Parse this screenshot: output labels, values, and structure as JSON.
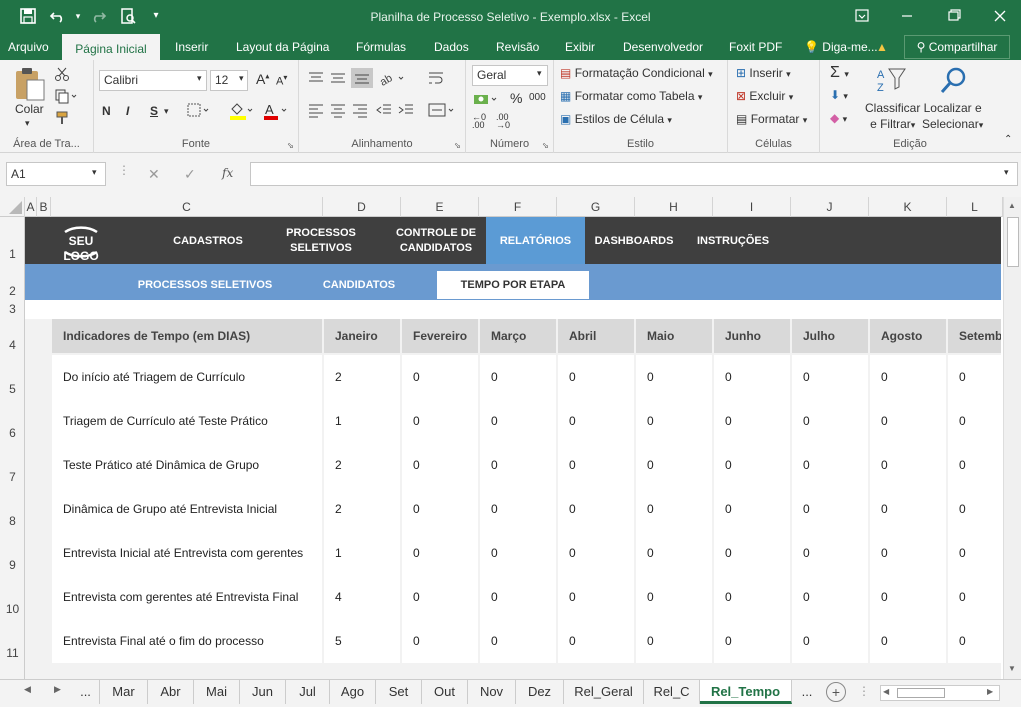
{
  "window": {
    "title": "Planilha de Processo Seletivo - Exemplo.xlsx - Excel"
  },
  "ribbon_tabs": [
    "Arquivo",
    "Página Inicial",
    "Inserir",
    "Layout da Página",
    "Fórmulas",
    "Dados",
    "Revisão",
    "Exibir",
    "Desenvolvedor",
    "Foxit PDF"
  ],
  "tell_me": "Diga-me...",
  "share": "Compartilhar",
  "clipboard": {
    "paste": "Colar",
    "label": "Área de Tra..."
  },
  "font": {
    "name": "Calibri",
    "size": "12",
    "bold": "N",
    "italic": "I",
    "underline": "S",
    "label": "Fonte"
  },
  "alignment": {
    "label": "Alinhamento"
  },
  "number": {
    "format": "Geral",
    "label": "Número"
  },
  "styles": {
    "cond": "Formatação Condicional",
    "table": "Formatar como Tabela",
    "cell": "Estilos de Célula",
    "label": "Estilo"
  },
  "cells": {
    "insert": "Inserir",
    "delete": "Excluir",
    "format": "Formatar",
    "label": "Células"
  },
  "editing": {
    "sort1": "Classificar",
    "sort2": "e Filtrar",
    "find1": "Localizar e",
    "find2": "Selecionar",
    "label": "Edição"
  },
  "formula_bar": {
    "name_box": "A1",
    "fx": "fx",
    "content": ""
  },
  "columns": [
    "A",
    "B",
    "C",
    "D",
    "E",
    "F",
    "G",
    "H",
    "I",
    "J",
    "K",
    "L"
  ],
  "rows": [
    "1",
    "2",
    "3",
    "4",
    "5",
    "6",
    "7",
    "8",
    "9",
    "10",
    "11"
  ],
  "nav": {
    "logo": "SEU LOGO",
    "items": [
      {
        "label": "CADASTROS"
      },
      {
        "label": "PROCESSOS\nSELETIVOS"
      },
      {
        "label": "CONTROLE DE\nCANDIDATOS"
      },
      {
        "label": "RELATÓRIOS"
      },
      {
        "label": "DASHBOARDS"
      },
      {
        "label": "INSTRUÇÕES"
      }
    ]
  },
  "subnav": [
    "PROCESSOS SELETIVOS",
    "CANDIDATOS",
    "TEMPO POR ETAPA"
  ],
  "table": {
    "header": [
      "Indicadores de Tempo (em DIAS)",
      "Janeiro",
      "Fevereiro",
      "Março",
      "Abril",
      "Maio",
      "Junho",
      "Julho",
      "Agosto",
      "Setemb"
    ],
    "rows": [
      {
        "label": "Do início até Triagem de Currículo",
        "values": [
          "2",
          "0",
          "0",
          "0",
          "0",
          "0",
          "0",
          "0",
          "0"
        ]
      },
      {
        "label": "Triagem de Currículo até Teste Prático",
        "values": [
          "1",
          "0",
          "0",
          "0",
          "0",
          "0",
          "0",
          "0",
          "0"
        ]
      },
      {
        "label": "Teste Prático até Dinâmica de Grupo",
        "values": [
          "2",
          "0",
          "0",
          "0",
          "0",
          "0",
          "0",
          "0",
          "0"
        ]
      },
      {
        "label": "Dinâmica de Grupo até Entrevista Inicial",
        "values": [
          "2",
          "0",
          "0",
          "0",
          "0",
          "0",
          "0",
          "0",
          "0"
        ]
      },
      {
        "label": "Entrevista Inicial até Entrevista com gerentes",
        "values": [
          "1",
          "0",
          "0",
          "0",
          "0",
          "0",
          "0",
          "0",
          "0"
        ]
      },
      {
        "label": "Entrevista com gerentes até Entrevista Final",
        "values": [
          "4",
          "0",
          "0",
          "0",
          "0",
          "0",
          "0",
          "0",
          "0"
        ]
      },
      {
        "label": "Entrevista Final até o fim do processo",
        "values": [
          "5",
          "0",
          "0",
          "0",
          "0",
          "0",
          "0",
          "0",
          "0"
        ]
      }
    ]
  },
  "sheets": [
    "...",
    "Mar",
    "Abr",
    "Mai",
    "Jun",
    "Jul",
    "Ago",
    "Set",
    "Out",
    "Nov",
    "Dez",
    "Rel_Geral",
    "Rel_C",
    "Rel_Tempo",
    "..."
  ],
  "colors": {
    "excel_green": "#217346",
    "nav_dark": "#3f3f3f",
    "nav_active": "#5b9bd5",
    "subnav_blue": "#6a9ad0"
  }
}
